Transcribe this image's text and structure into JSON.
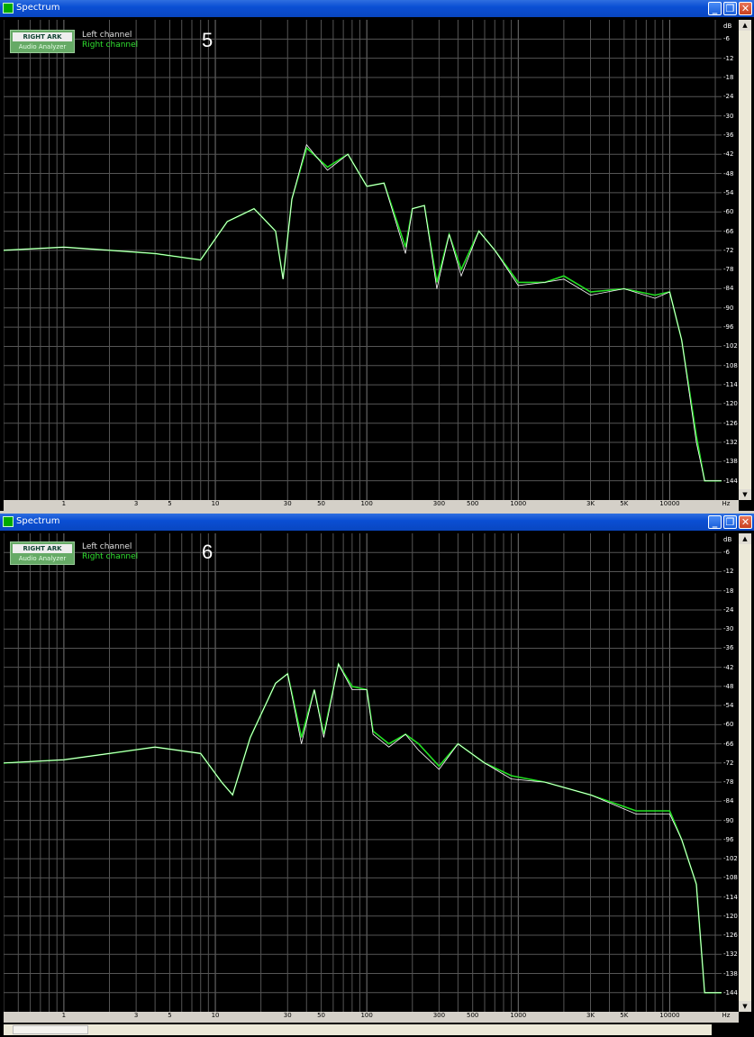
{
  "colors": {
    "left_channel": "#ffffff",
    "right_channel": "#22e022",
    "grid": "#555555",
    "background": "#000000"
  },
  "windows": [
    {
      "title": "Spectrum",
      "marker": "5",
      "logo": {
        "top": "RIGHT ARK",
        "bottom": "Audio Analyzer"
      },
      "legend": {
        "left": "Left channel",
        "right": "Right channel"
      },
      "y_unit": "dB",
      "x_unit": "Hz",
      "y_ticks": [
        "-6",
        "-12",
        "-18",
        "-24",
        "-30",
        "-36",
        "-42",
        "-48",
        "-54",
        "-60",
        "-66",
        "-72",
        "-78",
        "-84",
        "-90",
        "-96",
        "-102",
        "-108",
        "-114",
        "-120",
        "-126",
        "-132",
        "-138",
        "-144"
      ],
      "x_ticks": [
        "1",
        "3",
        "5",
        "10",
        "30",
        "50",
        "100",
        "300",
        "500",
        "1000",
        "3K",
        "5K",
        "10000"
      ]
    },
    {
      "title": "Spectrum",
      "marker": "6",
      "logo": {
        "top": "RIGHT ARK",
        "bottom": "Audio Analyzer"
      },
      "legend": {
        "left": "Left channel",
        "right": "Right channel"
      },
      "y_unit": "dB",
      "x_unit": "Hz",
      "y_ticks": [
        "-6",
        "-12",
        "-18",
        "-24",
        "-30",
        "-36",
        "-42",
        "-48",
        "-54",
        "-60",
        "-66",
        "-72",
        "-78",
        "-84",
        "-90",
        "-96",
        "-102",
        "-108",
        "-114",
        "-120",
        "-126",
        "-132",
        "-138",
        "-144"
      ],
      "x_ticks": [
        "1",
        "3",
        "5",
        "10",
        "30",
        "50",
        "100",
        "300",
        "500",
        "1000",
        "3K",
        "5K",
        "10000"
      ]
    }
  ],
  "chart_data": [
    {
      "type": "line",
      "xscale": "log",
      "xlim": [
        0.4,
        22000
      ],
      "ylim": [
        -150,
        0
      ],
      "xlabel": "Hz",
      "ylabel": "dB",
      "grid": true,
      "legend_position": "top-left",
      "series": [
        {
          "name": "Left channel",
          "points": [
            [
              0.4,
              -72
            ],
            [
              1,
              -71
            ],
            [
              2,
              -72
            ],
            [
              4,
              -73
            ],
            [
              8,
              -75
            ],
            [
              12,
              -63
            ],
            [
              18,
              -59
            ],
            [
              25,
              -66
            ],
            [
              28,
              -81
            ],
            [
              32,
              -56
            ],
            [
              40,
              -39
            ],
            [
              55,
              -47
            ],
            [
              75,
              -42
            ],
            [
              100,
              -52
            ],
            [
              130,
              -51
            ],
            [
              180,
              -73
            ],
            [
              200,
              -59
            ],
            [
              240,
              -58
            ],
            [
              290,
              -84
            ],
            [
              350,
              -67
            ],
            [
              420,
              -80
            ],
            [
              550,
              -66
            ],
            [
              700,
              -72
            ],
            [
              1000,
              -83
            ],
            [
              1500,
              -82
            ],
            [
              2000,
              -81
            ],
            [
              3000,
              -86
            ],
            [
              5000,
              -84
            ],
            [
              8000,
              -87
            ],
            [
              10000,
              -85
            ],
            [
              12000,
              -100
            ],
            [
              15000,
              -132
            ],
            [
              17000,
              -144
            ],
            [
              22000,
              -144
            ]
          ]
        },
        {
          "name": "Right channel",
          "points": [
            [
              0.4,
              -72
            ],
            [
              1,
              -71
            ],
            [
              2,
              -72
            ],
            [
              4,
              -73
            ],
            [
              8,
              -75
            ],
            [
              12,
              -63
            ],
            [
              18,
              -59
            ],
            [
              25,
              -66
            ],
            [
              28,
              -81
            ],
            [
              32,
              -56
            ],
            [
              40,
              -40
            ],
            [
              55,
              -46
            ],
            [
              75,
              -42
            ],
            [
              100,
              -52
            ],
            [
              130,
              -51
            ],
            [
              180,
              -71
            ],
            [
              200,
              -59
            ],
            [
              240,
              -58
            ],
            [
              290,
              -82
            ],
            [
              350,
              -67
            ],
            [
              420,
              -78
            ],
            [
              550,
              -66
            ],
            [
              700,
              -72
            ],
            [
              1000,
              -82
            ],
            [
              1500,
              -82
            ],
            [
              2000,
              -80
            ],
            [
              3000,
              -85
            ],
            [
              5000,
              -84
            ],
            [
              8000,
              -86
            ],
            [
              10000,
              -85
            ],
            [
              12000,
              -100
            ],
            [
              15000,
              -130
            ],
            [
              17000,
              -144
            ],
            [
              22000,
              -144
            ]
          ]
        }
      ]
    },
    {
      "type": "line",
      "xscale": "log",
      "xlim": [
        0.4,
        22000
      ],
      "ylim": [
        -150,
        0
      ],
      "xlabel": "Hz",
      "ylabel": "dB",
      "grid": true,
      "legend_position": "top-left",
      "series": [
        {
          "name": "Left channel",
          "points": [
            [
              0.4,
              -72
            ],
            [
              1,
              -71
            ],
            [
              2,
              -69
            ],
            [
              4,
              -67
            ],
            [
              8,
              -69
            ],
            [
              11,
              -78
            ],
            [
              13,
              -82
            ],
            [
              17,
              -64
            ],
            [
              25,
              -47
            ],
            [
              30,
              -44
            ],
            [
              37,
              -66
            ],
            [
              45,
              -49
            ],
            [
              52,
              -64
            ],
            [
              65,
              -41
            ],
            [
              80,
              -49
            ],
            [
              100,
              -49
            ],
            [
              110,
              -63
            ],
            [
              140,
              -67
            ],
            [
              180,
              -63
            ],
            [
              220,
              -68
            ],
            [
              300,
              -74
            ],
            [
              400,
              -66
            ],
            [
              600,
              -72
            ],
            [
              900,
              -77
            ],
            [
              1500,
              -78
            ],
            [
              3000,
              -82
            ],
            [
              6000,
              -88
            ],
            [
              10000,
              -88
            ],
            [
              12000,
              -96
            ],
            [
              15000,
              -110
            ],
            [
              17000,
              -144
            ],
            [
              22000,
              -144
            ]
          ]
        },
        {
          "name": "Right channel",
          "points": [
            [
              0.4,
              -72
            ],
            [
              1,
              -71
            ],
            [
              2,
              -69
            ],
            [
              4,
              -67
            ],
            [
              8,
              -69
            ],
            [
              11,
              -78
            ],
            [
              13,
              -82
            ],
            [
              17,
              -64
            ],
            [
              25,
              -47
            ],
            [
              30,
              -44
            ],
            [
              37,
              -64
            ],
            [
              45,
              -49
            ],
            [
              52,
              -63
            ],
            [
              65,
              -41
            ],
            [
              80,
              -48
            ],
            [
              100,
              -49
            ],
            [
              110,
              -62
            ],
            [
              140,
              -66
            ],
            [
              180,
              -63
            ],
            [
              220,
              -66
            ],
            [
              300,
              -73
            ],
            [
              400,
              -66
            ],
            [
              600,
              -72
            ],
            [
              900,
              -76
            ],
            [
              1500,
              -78
            ],
            [
              3000,
              -82
            ],
            [
              6000,
              -87
            ],
            [
              10000,
              -87
            ],
            [
              12000,
              -96
            ],
            [
              15000,
              -110
            ],
            [
              17000,
              -144
            ],
            [
              22000,
              -144
            ]
          ]
        }
      ]
    }
  ]
}
